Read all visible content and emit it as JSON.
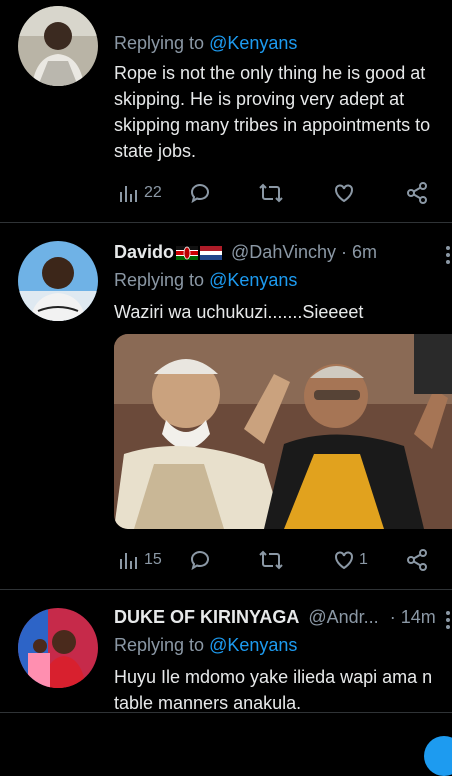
{
  "tweets": [
    {
      "reply_prefix": "Replying to",
      "reply_handle": "@Kenyans",
      "text": "Rope is not the only thing he is good at skipping. He is proving very adept at skipping many tribes in appointments to state jobs.",
      "views": "22",
      "likes": ""
    },
    {
      "name": "Davido",
      "handle": "@DahVinchy",
      "time": "· 6m",
      "reply_prefix": "Replying to",
      "reply_handle": "@Kenyans",
      "text": "Waziri wa uchukuzi.......Sieeeet",
      "views": "15",
      "likes": "1"
    },
    {
      "name": "DUKE OF KIRINYAGA",
      "handle": "@Andr...",
      "time": "· 14m",
      "reply_prefix": "Replying to",
      "reply_handle": "@Kenyans",
      "text": "Huyu Ile mdomo yake ilieda wapi ama n table manners anakula."
    }
  ],
  "colors": {
    "background": "#000000",
    "text": "#e7e9ea",
    "muted": "#8b98a5",
    "link": "#1d9bf0",
    "divider": "#2f3336"
  },
  "icons": [
    "views-icon",
    "reply-icon",
    "retweet-icon",
    "like-icon",
    "share-icon",
    "more-icon"
  ]
}
